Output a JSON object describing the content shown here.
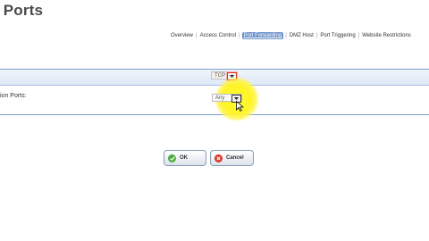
{
  "page": {
    "title": "r Ports"
  },
  "tabs": [
    {
      "label": "Overview",
      "active": false
    },
    {
      "label": "Access Control",
      "active": false
    },
    {
      "label": "Port Forwarding",
      "active": true
    },
    {
      "label": "DMZ Host",
      "active": false
    },
    {
      "label": "Port Triggering",
      "active": false
    },
    {
      "label": "Website Restrictions",
      "active": false
    }
  ],
  "form": {
    "protocol_value": "TCP",
    "ports_label": "ion Ports:",
    "ports_value": "Any"
  },
  "buttons": {
    "ok": "OK",
    "cancel": "Cancel"
  },
  "colors": {
    "accent": "#6c93c9",
    "highlight": "#fff429",
    "ok_icon": "#4caa3c",
    "cancel_icon": "#d8362b"
  }
}
